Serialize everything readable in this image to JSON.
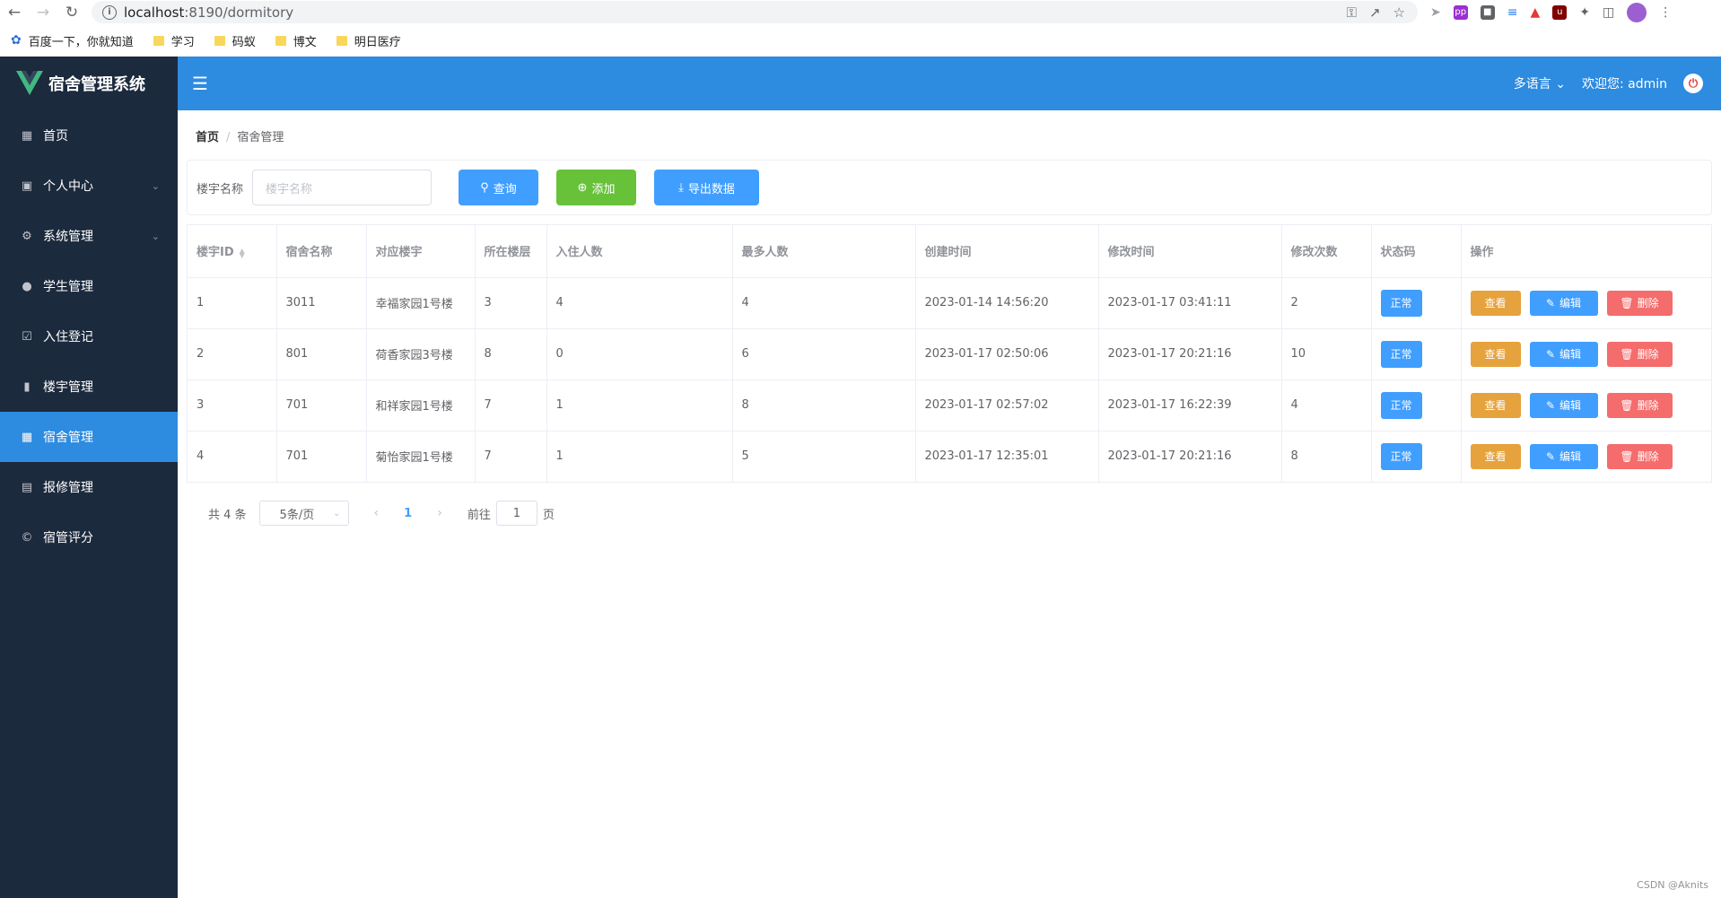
{
  "browser": {
    "url_host": "localhost",
    "url_path": ":8190/dormitory",
    "bookmarks": [
      {
        "label": "百度一下，你就知道",
        "icon": "baidu-paw-icon"
      },
      {
        "label": "学习",
        "icon": "folder-icon"
      },
      {
        "label": "码蚁",
        "icon": "folder-icon"
      },
      {
        "label": "博文",
        "icon": "folder-icon"
      },
      {
        "label": "明日医疗",
        "icon": "folder-icon"
      }
    ]
  },
  "sidebar": {
    "title": "宿舍管理系统",
    "items": [
      {
        "label": "首页",
        "icon": "grid-icon",
        "has_children": false,
        "active": false
      },
      {
        "label": "个人中心",
        "icon": "briefcase-icon",
        "has_children": true,
        "active": false
      },
      {
        "label": "系统管理",
        "icon": "gear-icon",
        "has_children": true,
        "active": false
      },
      {
        "label": "学生管理",
        "icon": "user-icon",
        "has_children": false,
        "active": false
      },
      {
        "label": "入住登记",
        "icon": "clipboard-check-icon",
        "has_children": false,
        "active": false
      },
      {
        "label": "楼宇管理",
        "icon": "bar-chart-icon",
        "has_children": false,
        "active": false
      },
      {
        "label": "宿舍管理",
        "icon": "table-icon",
        "has_children": false,
        "active": true
      },
      {
        "label": "报修管理",
        "icon": "clipboard-icon",
        "has_children": false,
        "active": false
      },
      {
        "label": "宿管评分",
        "icon": "copyright-icon",
        "has_children": false,
        "active": false
      }
    ]
  },
  "header": {
    "language_label": "多语言",
    "welcome_label": "欢迎您: admin"
  },
  "breadcrumb": {
    "home": "首页",
    "current": "宿舍管理"
  },
  "search": {
    "label": "楼宇名称",
    "placeholder": "楼宇名称",
    "query_label": "查询",
    "add_label": "添加",
    "export_label": "导出数据"
  },
  "table": {
    "columns": [
      "楼宇ID",
      "宿舍名称",
      "对应楼宇",
      "所在楼层",
      "入住人数",
      "最多人数",
      "创建时间",
      "修改时间",
      "修改次数",
      "状态码",
      "操作"
    ],
    "rows": [
      {
        "id": "1",
        "name": "3011",
        "building": "幸福家园1号楼",
        "floor": "3",
        "occupants": "4",
        "max": "4",
        "created": "2023-01-14 14:56:20",
        "modified": "2023-01-17 03:41:11",
        "edits": "2",
        "status": "正常"
      },
      {
        "id": "2",
        "name": "801",
        "building": "荷香家园3号楼",
        "floor": "8",
        "occupants": "0",
        "max": "6",
        "created": "2023-01-17 02:50:06",
        "modified": "2023-01-17 20:21:16",
        "edits": "10",
        "status": "正常"
      },
      {
        "id": "3",
        "name": "701",
        "building": "和祥家园1号楼",
        "floor": "7",
        "occupants": "1",
        "max": "8",
        "created": "2023-01-17 02:57:02",
        "modified": "2023-01-17 16:22:39",
        "edits": "4",
        "status": "正常"
      },
      {
        "id": "4",
        "name": "701",
        "building": "菊怡家园1号楼",
        "floor": "7",
        "occupants": "1",
        "max": "5",
        "created": "2023-01-17 12:35:01",
        "modified": "2023-01-17 20:21:16",
        "edits": "8",
        "status": "正常"
      }
    ],
    "actions": {
      "view": "查看",
      "edit": "编辑",
      "delete": "删除"
    }
  },
  "pagination": {
    "total": "共 4 条",
    "page_size": "5条/页",
    "current_page": "1",
    "goto_label": "前往",
    "goto_value": "1",
    "goto_suffix": "页"
  },
  "watermark": "CSDN @Aknits"
}
